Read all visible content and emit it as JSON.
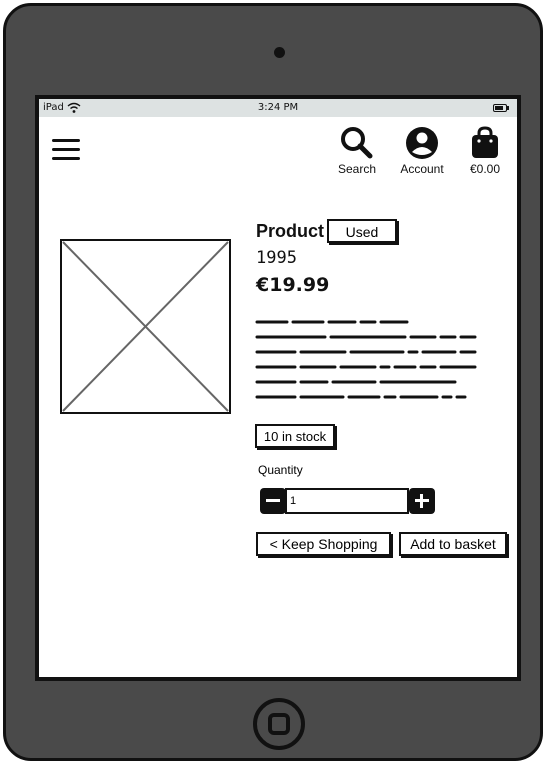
{
  "status": {
    "carrier": "iPad",
    "time": "3:24 PM"
  },
  "header": {
    "search_label": "Search",
    "account_label": "Account",
    "basket_total": "€0.00"
  },
  "product": {
    "title": "Product",
    "condition": "Used",
    "year": "1995",
    "price": "€19.99",
    "stock": "10 in stock"
  },
  "quantity": {
    "label": "Quantity",
    "value": "1"
  },
  "actions": {
    "keep_shopping": "< Keep Shopping",
    "add_to_basket": "Add to basket"
  }
}
